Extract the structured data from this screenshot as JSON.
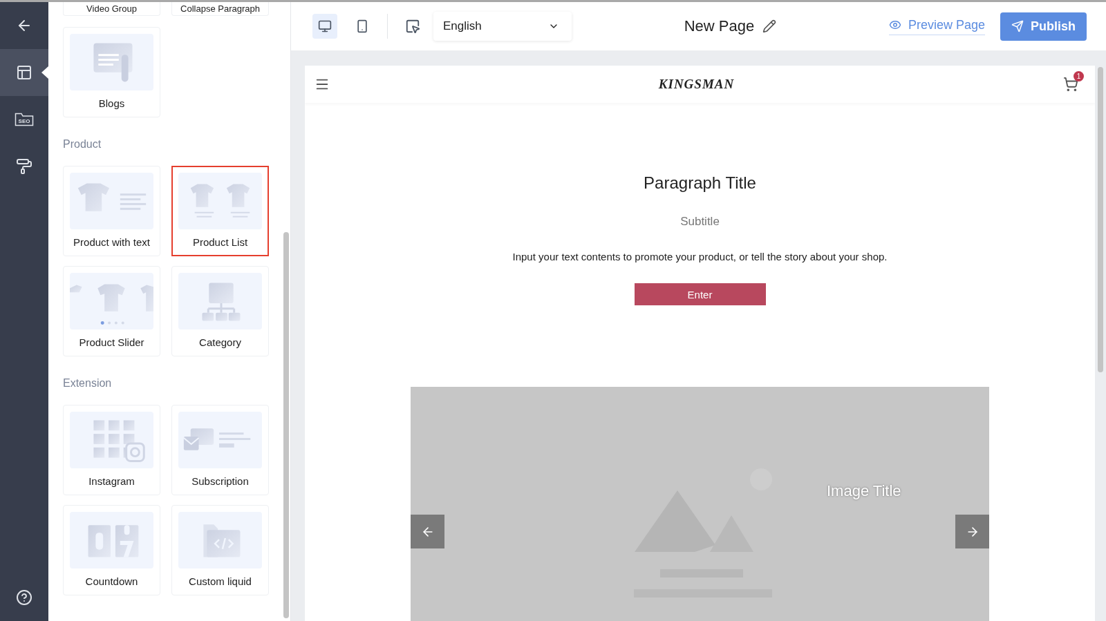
{
  "nav": [
    {
      "kind": "layout",
      "selected": true
    },
    {
      "kind": "seo",
      "label": "SEO",
      "selected": false
    },
    {
      "kind": "style",
      "selected": false
    }
  ],
  "sections": [
    {
      "cards": [
        {
          "kind": "cut",
          "label": "Video Group",
          "selected": false
        },
        {
          "kind": "cut",
          "label": "Collapse Paragraph",
          "selected": false
        },
        {
          "kind": "blogs",
          "label": "Blogs",
          "selected": false
        }
      ]
    },
    {
      "heading": "Product",
      "cards": [
        {
          "kind": "product-text",
          "label": "Product with text",
          "selected": false
        },
        {
          "kind": "product-list",
          "label": "Product List",
          "selected": true
        },
        {
          "kind": "product-slider",
          "label": "Product Slider",
          "selected": false
        },
        {
          "kind": "category",
          "label": "Category",
          "selected": false
        }
      ]
    },
    {
      "heading": "Extension",
      "cards": [
        {
          "kind": "instagram",
          "label": "Instagram",
          "selected": false
        },
        {
          "kind": "subscription",
          "label": "Subscription",
          "selected": false
        },
        {
          "kind": "countdown",
          "label": "Countdown",
          "selected": false
        },
        {
          "kind": "custom-liquid",
          "label": "Custom liquid",
          "selected": false
        }
      ]
    }
  ],
  "toolbar": {
    "devices": [
      {
        "kind": "desktop",
        "selected": true
      },
      {
        "kind": "mobile",
        "selected": false
      }
    ],
    "language": "English",
    "page_title": "New Page",
    "preview": "Preview Page",
    "publish": "Publish"
  },
  "site": {
    "brand": "KINGSMAN",
    "cart_count": "1",
    "title": "Paragraph Title",
    "subtitle": "Subtitle",
    "body": "Input your text contents to promote your product, or tell the story about your shop.",
    "button": "Enter",
    "banner": {
      "image_title": "Image Title"
    }
  }
}
